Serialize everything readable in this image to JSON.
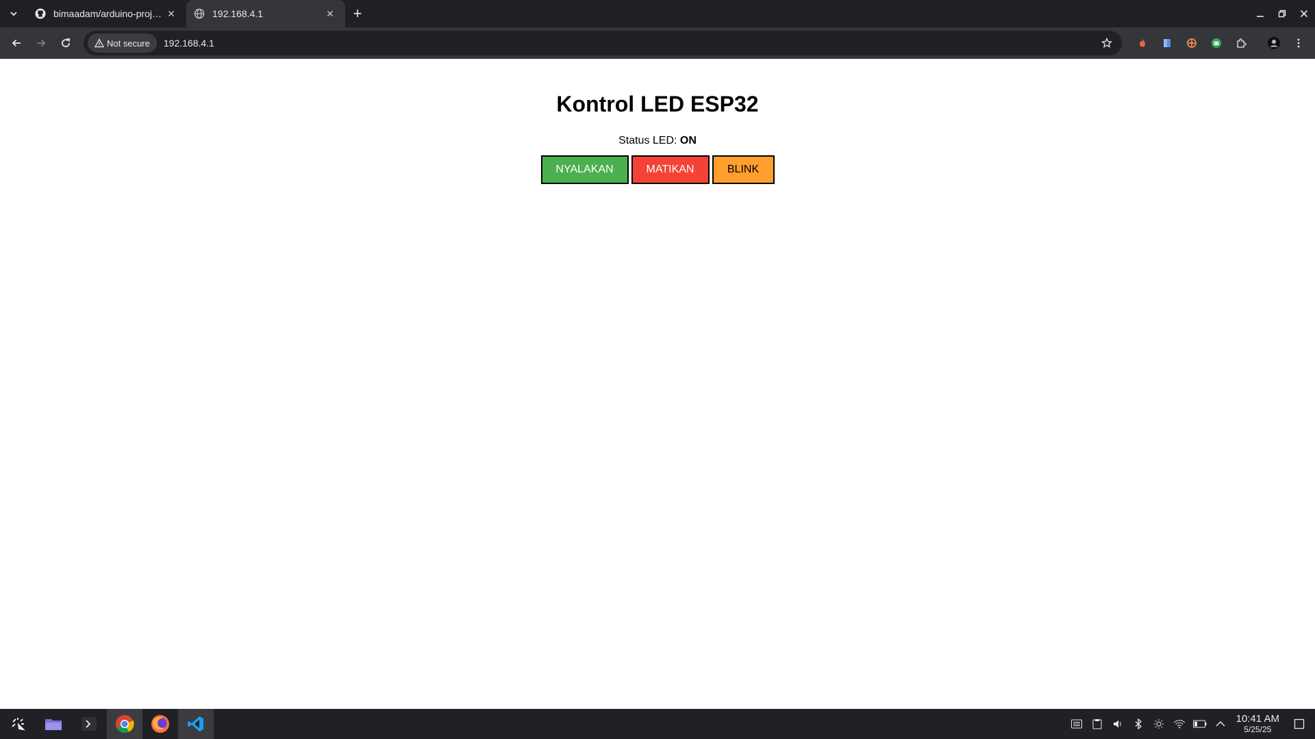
{
  "browser": {
    "tabs": [
      {
        "title": "bimaadam/arduino-project",
        "icon": "github-icon",
        "active": false
      },
      {
        "title": "192.168.4.1",
        "icon": "globe-icon",
        "active": true
      }
    ],
    "security_label": "Not secure",
    "url": "192.168.4.1"
  },
  "page": {
    "heading": "Kontrol LED ESP32",
    "status_label": "Status LED:",
    "status_value": "ON",
    "buttons": {
      "on_label": "NYALAKAN",
      "off_label": "MATIKAN",
      "blink_label": "BLINK"
    },
    "colors": {
      "on": "#4caf50",
      "off": "#f44336",
      "blink": "#ff9f2e"
    }
  },
  "taskbar": {
    "apps": [
      "launcher-icon",
      "files-icon",
      "terminal-icon",
      "chrome-icon",
      "firefox-icon",
      "vscode-icon"
    ],
    "time": "10:41 AM",
    "date": "5/25/25"
  }
}
